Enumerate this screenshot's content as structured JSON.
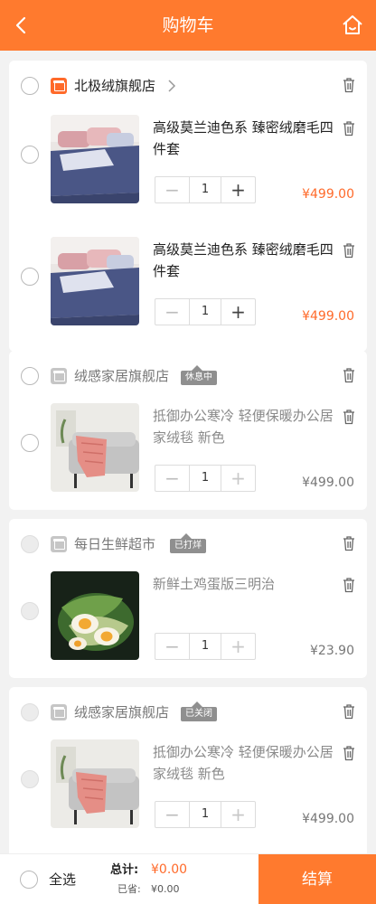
{
  "header": {
    "title": "购物车"
  },
  "shops": [
    {
      "name": "北极绒旗舰店",
      "badge": "",
      "items": [
        {
          "title": "高级莫兰迪色系 臻密绒磨毛四件套",
          "qty": "1",
          "price": "¥499.00"
        },
        {
          "title": "高级莫兰迪色系 臻密绒磨毛四件套",
          "qty": "1",
          "price": "¥499.00"
        }
      ]
    },
    {
      "name": "绒感家居旗舰店",
      "badge": "休息中",
      "items": [
        {
          "title": "抵御办公寒冷 轻便保暖办公居家绒毯 新色",
          "qty": "1",
          "price": "¥499.00"
        }
      ]
    },
    {
      "name": "每日生鲜超市",
      "badge": "已打烊",
      "items": [
        {
          "title": "新鲜土鸡蛋版三明治",
          "qty": "1",
          "price": "¥23.90"
        }
      ]
    },
    {
      "name": "绒感家居旗舰店",
      "badge": "已关闭",
      "items": [
        {
          "title": "抵御办公寒冷 轻便保暖办公居家绒毯 新色",
          "qty": "1",
          "price": "¥499.00"
        }
      ]
    }
  ],
  "stepper": {
    "minus": "−",
    "plus": "+"
  },
  "footer": {
    "select_all": "全选",
    "total_label": "总计:",
    "total_value": "¥0.00",
    "saved_label": "已省:",
    "saved_value": "¥0.00",
    "checkout": "结算"
  },
  "colors": {
    "accent": "#ff7a2e",
    "price": "#ff6a2a"
  }
}
